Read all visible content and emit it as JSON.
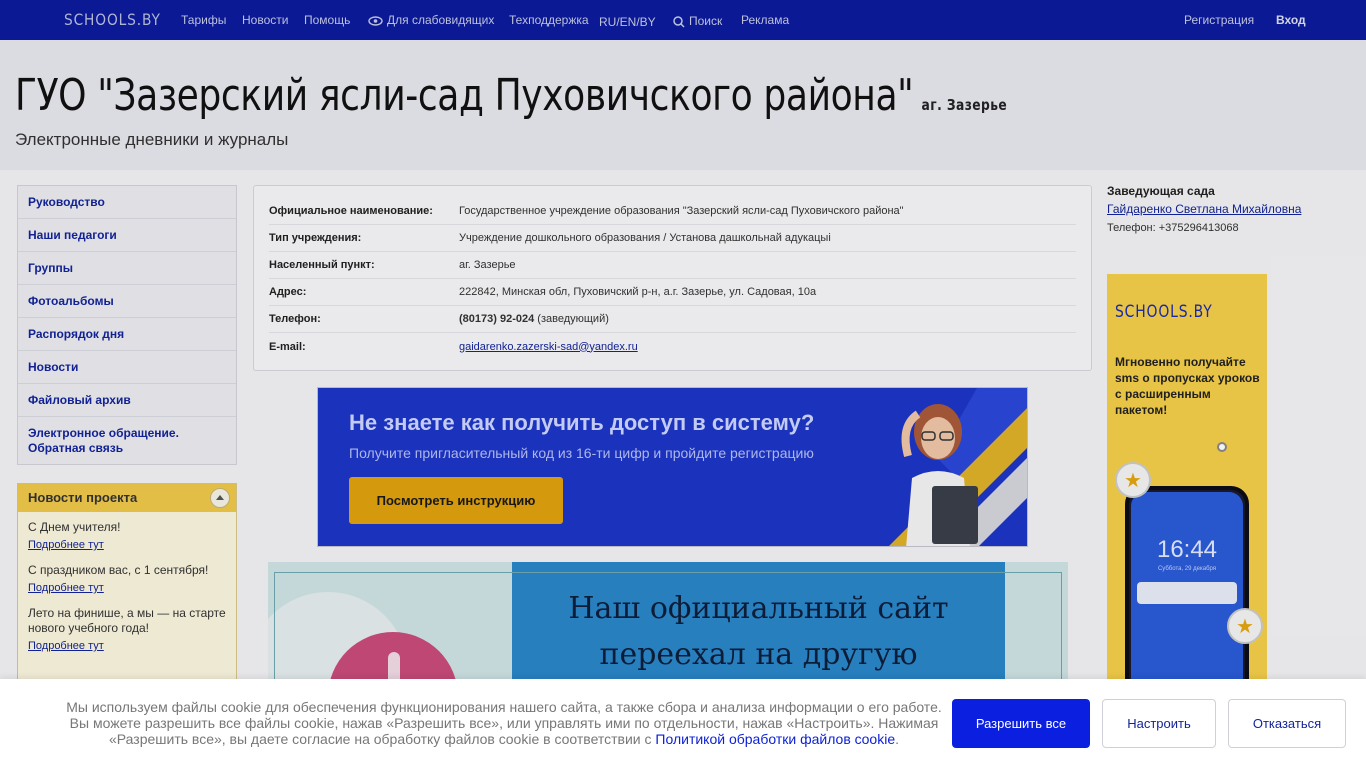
{
  "nav": {
    "logo": "SCHOOLS.BY",
    "items": [
      "Тарифы",
      "Новости",
      "Помощь",
      "Для слабовидящих",
      "Техподдержка",
      "RU/EN/BY",
      "Поиск",
      "Реклама"
    ],
    "register": "Регистрация",
    "login": "Вход"
  },
  "header": {
    "title": "ГУО \"Зазерский ясли-сад Пуховичского района\"",
    "location": "аг. Зазерье",
    "subtitle": "Электронные дневники и журналы"
  },
  "sidebar": {
    "items": [
      "Руководство",
      "Наши педагоги",
      "Группы",
      "Фотоальбомы",
      "Распорядок дня",
      "Новости",
      "Файловый архив",
      "Электронное обращение. Обратная связь"
    ]
  },
  "project_news": {
    "title": "Новости проекта",
    "items": [
      {
        "title": "С Днем учителя!",
        "more": "Подробнее тут"
      },
      {
        "title": "С праздником вас, с 1 сентября!",
        "more": "Подробнее тут"
      },
      {
        "title": "Лето на финише, а мы — на старте нового учебного года!",
        "more": "Подробнее тут"
      }
    ]
  },
  "info": {
    "rows": [
      {
        "label": "Официальное наименование:",
        "value": "Государственное учреждение образования \"Зазерский ясли-сад Пуховичского района\""
      },
      {
        "label": "Тип учреждения:",
        "value": "Учреждение дошкольного образования / Установа дашкольнай адукацыі"
      },
      {
        "label": "Населенный пункт:",
        "value": "аг. Зазерье"
      },
      {
        "label": "Адрес:",
        "value": "222842, Минская обл, Пуховичский р-н, а.г. Зазерье, ул. Садовая, 10а"
      },
      {
        "label": "Телефон:",
        "value_strong": "(80173) 92-024",
        "value": " (заведующий)"
      },
      {
        "label": "E-mail:",
        "link": "gaidarenko.zazerski-sad@yandex.ru"
      }
    ]
  },
  "banner1": {
    "title": "Не знаете как получить доступ в систему?",
    "subtitle": "Получите пригласительный код из 16-ти цифр и пройдите регистрацию",
    "button": "Посмотреть инструкцию"
  },
  "banner2": {
    "line1": "Наш официальный сайт",
    "line2": "переехал на другую"
  },
  "director": {
    "title": "Заведующая сада",
    "name": "Гайдаренко Светлана Михайловна",
    "phone": "Телефон: +375296413068"
  },
  "ad": {
    "logo": "SCHOOLS.BY",
    "text": "Мгновенно получайте sms о пропусках уроков с расширенным пакетом!",
    "time": "16:44",
    "date": "Суббота, 29 декабря"
  },
  "cookie": {
    "text": "Мы используем файлы cookie для обеспечения функционирования нашего сайта, а также сбора и анализа информации о его работе. Вы можете разрешить все файлы cookie, нажав «Разрешить все», или управлять ими по отдельности, нажав «Настроить». Нажимая «Разрешить все», вы даете согласие на обработку файлов cookie в соответствии с ",
    "link": "Политикой обработки файлов cookie",
    "end": ".",
    "allow": "Разрешить все",
    "configure": "Настроить",
    "decline": "Отказаться"
  }
}
